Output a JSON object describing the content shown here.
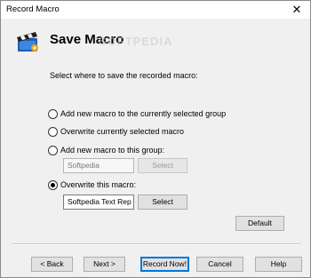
{
  "window": {
    "title": "Record Macro",
    "close_glyph": "✕"
  },
  "header": {
    "title": "Save Macro",
    "icon": "clapperboard-icon",
    "watermark": "SOFTPEDIA"
  },
  "instruction": "Select where to save the recorded macro:",
  "options": {
    "add_selected_group": "Add new macro to the currently selected group",
    "overwrite_selected": "Overwrite currently selected macro",
    "add_to_group": "Add new macro to this group:",
    "overwrite_this": "Overwrite this macro:"
  },
  "selected_option": "overwrite_this",
  "group_field": {
    "value": "Softpedia"
  },
  "macro_field": {
    "value": "Softpedia Text Rep"
  },
  "buttons": {
    "group_select": "Select",
    "macro_select": "Select",
    "default": "Default",
    "back": "< Back",
    "next": "Next >",
    "record_now": "Record Now!",
    "cancel": "Cancel",
    "help": "Help"
  },
  "colors": {
    "background": "#f0f0f0",
    "titlebar": "#ffffff",
    "focus_border": "#0078d7"
  }
}
